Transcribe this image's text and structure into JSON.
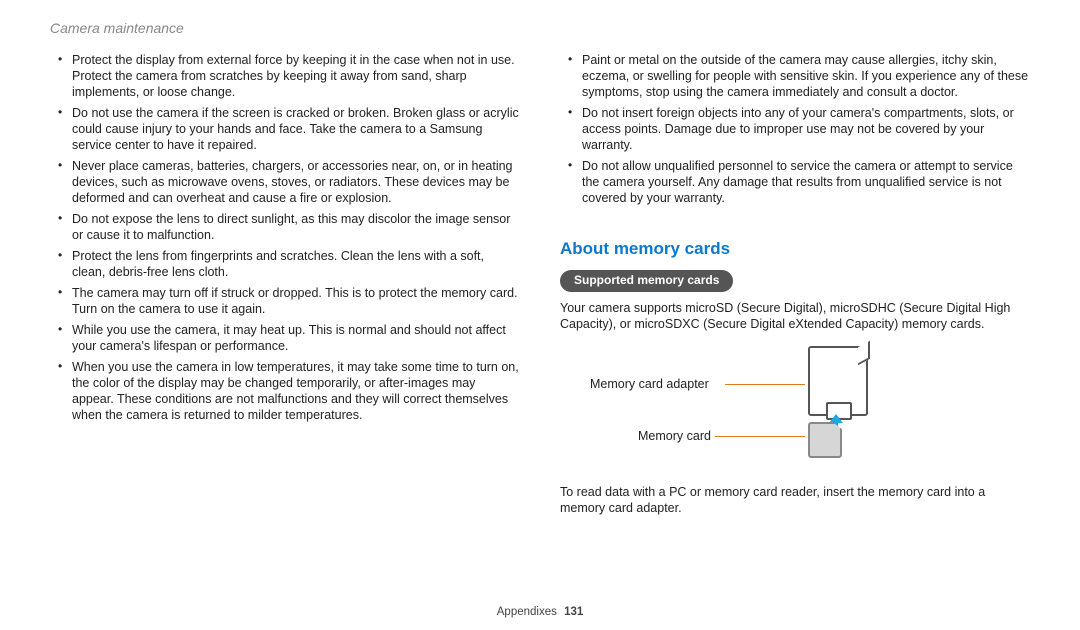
{
  "header": "Camera maintenance",
  "left_bullets": [
    "Protect the display from external force by keeping it in the case when not in use. Protect the camera from scratches by keeping it away from sand, sharp implements, or loose change.",
    "Do not use the camera if the screen is cracked or broken. Broken glass or acrylic could cause injury to your hands and face. Take the camera to a Samsung service center to have it repaired.",
    "Never place cameras, batteries, chargers, or accessories near, on, or in heating devices, such as microwave ovens, stoves, or radiators. These devices may be deformed and can overheat and cause a fire or explosion.",
    "Do not expose the lens to direct sunlight, as this may discolor the image sensor or cause it to malfunction.",
    "Protect the lens from fingerprints and scratches. Clean the lens with a soft, clean, debris-free lens cloth.",
    "The camera may turn off if struck or dropped. This is to protect the memory card. Turn on the camera to use it again.",
    "While you use the camera, it may heat up. This is normal and should not affect your camera's lifespan or performance.",
    "When you use the camera in low temperatures, it may take some time to turn on, the color of the display may be changed temporarily, or after-images may appear. These conditions are not malfunctions and they will correct themselves when the camera is returned to milder temperatures."
  ],
  "right_bullets": [
    "Paint or metal on the outside of the camera may cause allergies, itchy skin, eczema, or swelling for people with sensitive skin. If you experience any of these symptoms, stop using the camera immediately and consult a doctor.",
    "Do not insert foreign objects into any of your camera's compartments, slots, or access points. Damage due to improper use may not be covered by your warranty.",
    "Do not allow unqualified personnel to service the camera or attempt to service the camera yourself. Any damage that results from unqualified service is not covered by your warranty."
  ],
  "h2": "About memory cards",
  "pill": "Supported memory cards",
  "supported_text": "Your camera supports microSD (Secure Digital), microSDHC (Secure Digital High Capacity), or microSDXC (Secure Digital eXtended Capacity) memory cards.",
  "diagram": {
    "adapter_label": "Memory card adapter",
    "card_label": "Memory card"
  },
  "after_diagram": "To read data with a PC or memory card reader, insert the memory card into a memory card adapter.",
  "footer_label": "Appendixes",
  "page_number": "131"
}
